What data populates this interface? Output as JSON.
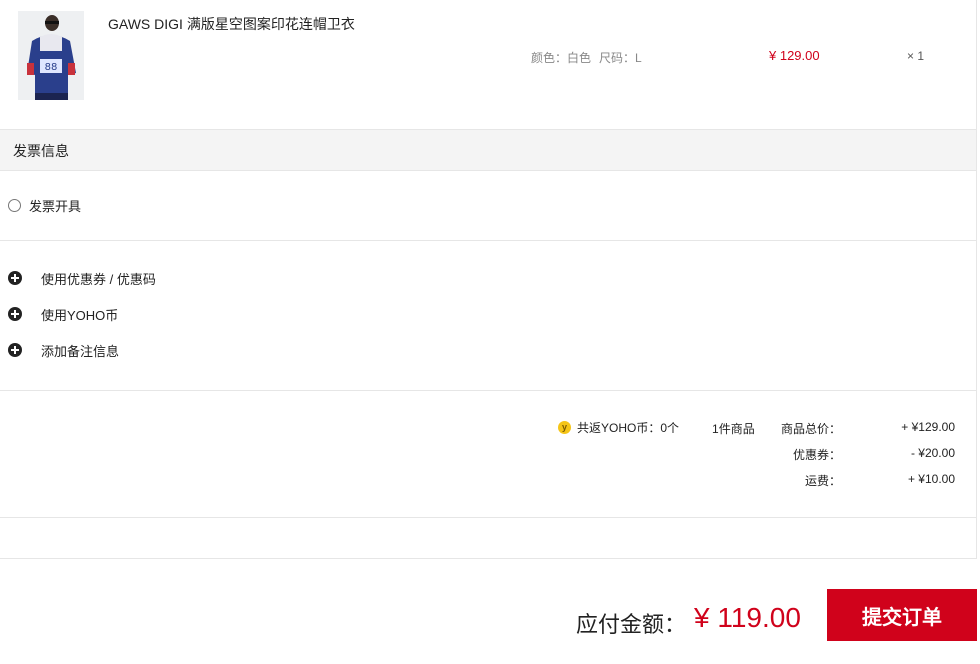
{
  "product": {
    "name": "GAWS DIGI 满版星空图案印花连帽卫衣",
    "color_attr": "颜色：白色",
    "size_attr": "尺码：L",
    "price": "¥ 129.00",
    "quantity": "× 1"
  },
  "invoice": {
    "section_title": "发票信息",
    "option_label": "发票开具"
  },
  "options": [
    {
      "label": "使用优惠券 / 优惠码"
    },
    {
      "label": "使用YOHO币"
    },
    {
      "label": "添加备注信息"
    }
  ],
  "summary": {
    "coin_icon_text": "y",
    "coin_text": "共返YOHO币：0个",
    "item_count_num": "1",
    "item_count_text": "件商品",
    "goods_total_label": "商品总价：",
    "goods_total_value": "+ ¥129.00",
    "coupon_label": "优惠券：",
    "coupon_value": "- ¥20.00",
    "shipping_label": "运费：",
    "shipping_value": "+ ¥10.00"
  },
  "footer": {
    "total_label": "应付金额：",
    "total_value": "¥ 119.00",
    "submit_label": "提交订单"
  },
  "colors": {
    "accent": "#d0021b",
    "coin": "#f5c518",
    "section_bg": "#f4f4f4"
  },
  "icons": [
    "product-thumbnail",
    "radio-icon",
    "plus-circle-icon",
    "yoho-coin-icon"
  ]
}
